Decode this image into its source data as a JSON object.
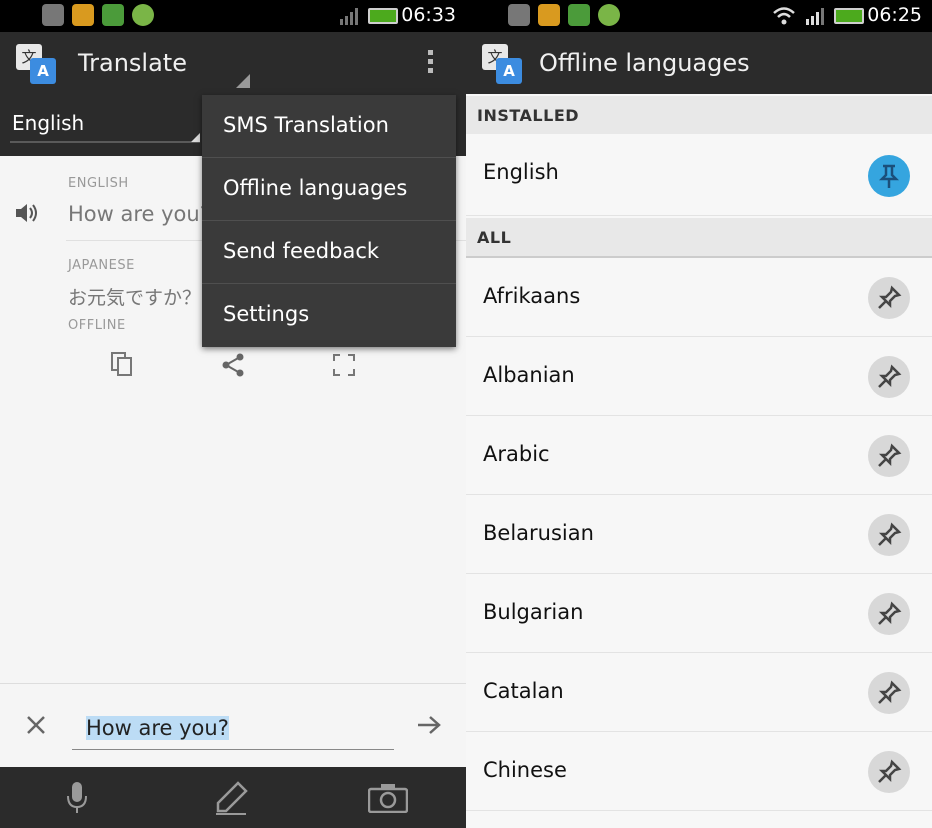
{
  "left": {
    "status": {
      "time": "06:33"
    },
    "actionbar": {
      "title": "Translate",
      "icon_left": "文",
      "icon_right": "A"
    },
    "language_spinner": {
      "value": "English"
    },
    "source": {
      "label": "ENGLISH",
      "text": "How are you?"
    },
    "target": {
      "label": "JAPANESE",
      "text": "お元気ですか？",
      "status": "OFFLINE"
    },
    "menu": [
      {
        "label": "SMS Translation"
      },
      {
        "label": "Offline languages"
      },
      {
        "label": "Send feedback"
      },
      {
        "label": "Settings"
      }
    ],
    "input": {
      "value": "How are you?"
    },
    "icons": [
      "speaker-icon",
      "copy-icon",
      "share-icon",
      "fullscreen-icon",
      "clear-icon",
      "go-arrow-icon",
      "microphone-icon",
      "pencil-icon",
      "camera-icon",
      "overflow-menu-icon"
    ]
  },
  "right": {
    "status": {
      "time": "06:25"
    },
    "actionbar": {
      "title": "Offline languages",
      "icon_left": "文",
      "icon_right": "A"
    },
    "installed_header": "INSTALLED",
    "installed": [
      {
        "name": "English"
      }
    ],
    "all_header": "ALL",
    "all": [
      {
        "name": "Afrikaans"
      },
      {
        "name": "Albanian"
      },
      {
        "name": "Arabic"
      },
      {
        "name": "Belarusian"
      },
      {
        "name": "Bulgarian"
      },
      {
        "name": "Catalan"
      },
      {
        "name": "Chinese"
      }
    ]
  },
  "colors": {
    "actionbar": "#2b2b2b",
    "pin_active": "#35a5df",
    "pin_inactive": "#d8d8d8",
    "battery": "#4caa1d"
  }
}
